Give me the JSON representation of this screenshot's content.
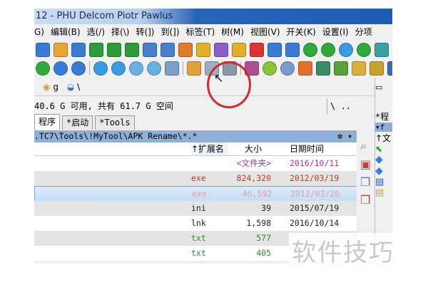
{
  "window": {
    "title": "12 - PHU Delcom Piotr Pawlus"
  },
  "menu": [
    "G)",
    "编辑(B)",
    "选(/)",
    "择(\\)",
    "转(])",
    "到(])",
    "标签(T)",
    "树(M)",
    "视图(V)",
    "开关(K)",
    "设置(I)",
    "分项"
  ],
  "drives": {
    "left_drive": "g",
    "left_path": "\\"
  },
  "free_space": "40.6 G 可用, 共有 61.7 G 空间",
  "nav_up": "\\ ..",
  "tabs": [
    "程序",
    "*启动",
    "*Tools"
  ],
  "right_tab": "*程",
  "path": ".TC7\\Tools\\!MyTool\\APK Rename\\*.*",
  "path_star": "✻ ▾",
  "columns": {
    "ext": "↑扩展名",
    "size": "大小",
    "date": "日期时间"
  },
  "right_col": "↑文",
  "right_path": "▾f",
  "rows": [
    {
      "ext": "",
      "size": "<文件夹>",
      "date": "2016/10/11",
      "color": "#9b3aa0"
    },
    {
      "ext": "exe",
      "size": "824,320",
      "date": "2012/03/19",
      "color": "#c0392b"
    },
    {
      "ext": "exe",
      "size": "46,592",
      "date": "2012/03/26",
      "color": "#e2a0a0",
      "selected": true
    },
    {
      "ext": "ini",
      "size": "39",
      "date": "2015/07/19",
      "color": "#222"
    },
    {
      "ext": "lnk",
      "size": "1,598",
      "date": "2016/10/14",
      "color": "#222"
    },
    {
      "ext": "txt",
      "size": "577",
      "date": "",
      "color": "#2e8b2e"
    },
    {
      "ext": "txt",
      "size": "405",
      "date": "",
      "color": "#2e8b2e"
    }
  ],
  "watermark": "软件技巧",
  "colors": {
    "toolbar1": [
      "#3a7bd5",
      "#e8a33a",
      "#3a7bd5",
      "#2e9b3a",
      "#2e9b3a",
      "#2e9b3a",
      "#4a7fc9",
      "#4a7fc9",
      "#e07b2a",
      "#e0b02a",
      "#8a5ec9",
      "#e0b02a",
      "#d33",
      "#3a7bd5",
      "#3a7bd5",
      "#2eaa3a",
      "#2eaa3a",
      "#3a9be0",
      "#2eaa3a",
      "#3aa0a0",
      "#3a7bd5"
    ],
    "toolbar2": [
      "#2eaa3a",
      "#3a7bd5",
      "#3a7bd5",
      "#3a9be0",
      "#3a9be0",
      "#6ab0e0",
      "#6ab0e0",
      "#7aa0c8",
      "#e0a040",
      "#9ab0c0",
      "#8899aa",
      "#b05090",
      "#8ac43a",
      "#7a9ad0",
      "#e07030",
      "#3a8a6a",
      "#5aa03a",
      "#d8b040",
      "#c8a030",
      "#3a6ab0"
    ]
  }
}
